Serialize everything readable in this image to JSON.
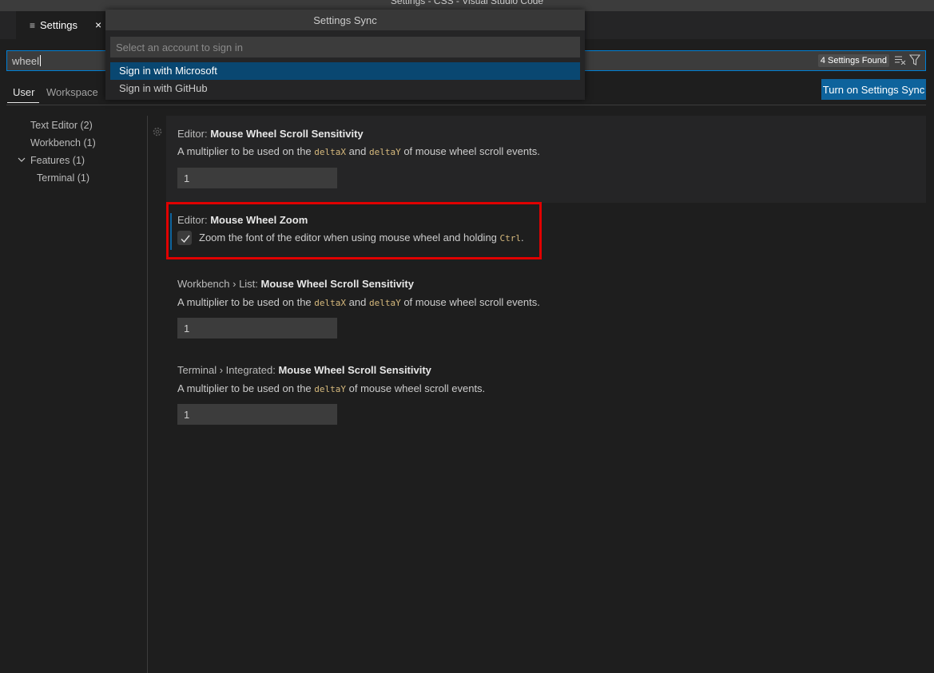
{
  "window": {
    "title": "Settings - CSS - Visual Studio Code"
  },
  "tab": {
    "label": "Settings",
    "close": "×"
  },
  "search": {
    "value": "wheel",
    "results_badge": "4 Settings Found"
  },
  "scope_tabs": {
    "user": "User",
    "workspace": "Workspace"
  },
  "sync_button": "Turn on Settings Sync",
  "toc": {
    "text_editor": "Text Editor (2)",
    "workbench": "Workbench (1)",
    "features": "Features (1)",
    "terminal": "Terminal (1)"
  },
  "settings": [
    {
      "category": "Editor: ",
      "name": "Mouse Wheel Scroll Sensitivity",
      "desc_pre": "A multiplier to be used on the ",
      "code1": "deltaX",
      "desc_mid": " and ",
      "code2": "deltaY",
      "desc_post": " of mouse wheel scroll events.",
      "value": "1"
    },
    {
      "category": "Editor: ",
      "name": "Mouse Wheel Zoom",
      "desc_pre": "Zoom the font of the editor when using mouse wheel and holding ",
      "code1": "Ctrl",
      "desc_post": ".",
      "checked": true
    },
    {
      "category": "Workbench › List: ",
      "name": "Mouse Wheel Scroll Sensitivity",
      "desc_pre": "A multiplier to be used on the ",
      "code1": "deltaX",
      "desc_mid": " and ",
      "code2": "deltaY",
      "desc_post": " of mouse wheel scroll events.",
      "value": "1"
    },
    {
      "category": "Terminal › Integrated: ",
      "name": "Mouse Wheel Scroll Sensitivity",
      "desc_pre": "A multiplier to be used on the ",
      "code1": "deltaY",
      "desc_post": " of mouse wheel scroll events.",
      "value": "1"
    }
  ],
  "quick_pick": {
    "title": "Settings Sync",
    "placeholder": "Select an account to sign in",
    "items": [
      "Sign in with Microsoft",
      "Sign in with GitHub"
    ],
    "selected_index": 0
  },
  "colors": {
    "accent": "#0e639c",
    "selection": "#094771",
    "highlight_box": "#e00000",
    "code": "#d7ba7d"
  },
  "icons": [
    "settings-tab-icon",
    "clear-filter-icon",
    "filter-icon",
    "gear-icon",
    "chevron-down-icon",
    "check-icon"
  ]
}
